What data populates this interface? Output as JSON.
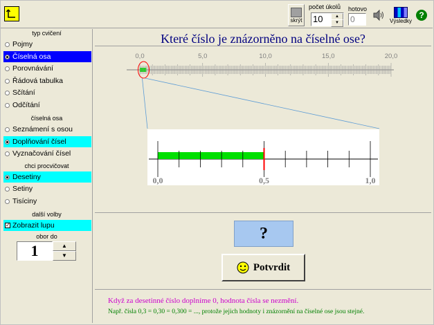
{
  "toolbar": {
    "hide_label": "skrýt",
    "task_count_label": "počet úkolů",
    "task_count_value": "10",
    "done_label": "hotovo",
    "done_value": "0",
    "results_label": "Výsledky",
    "help_symbol": "?"
  },
  "sidebar": {
    "section1_title": "typ cvičení",
    "section1_items": [
      "Pojmy",
      "Číselná osa",
      "Porovnávání",
      "Řádová tabulka",
      "Sčítání",
      "Odčítání"
    ],
    "section2_title": "číselná osa",
    "section2_items": [
      "Seznámení s osou",
      "Doplňování čísel",
      "Vyznačování čísel"
    ],
    "section3_title": "chci procvičovat",
    "section3_items": [
      "Desetiny",
      "Setiny",
      "Tisíciny"
    ],
    "section4_title": "další volby",
    "magnifier_label": "Zobrazit lupu",
    "range_label": "obor do",
    "range_value": "1"
  },
  "main": {
    "question": "Které číslo je znázorněno na číselné ose?",
    "axis_labels": [
      "0,0",
      "5,0",
      "10,0",
      "15,0",
      "20,0"
    ],
    "zoom_labels": [
      "0,0",
      "0,5",
      "1,0"
    ],
    "answer_placeholder": "?",
    "confirm_label": "Potvrdit",
    "hint1": "Když za desetinné číslo doplníme 0, hodnota čísla se nezmění.",
    "hint2": "Např. čísla 0,3 = 0,30 = 0,300 = ..., protože jejich hodnoty i znázornění na číselné ose jsou stejné."
  },
  "colors": {
    "highlight_blue": "#0000ff",
    "highlight_cyan": "#00ffff",
    "question_text": "#000080",
    "bar_fill": "#00e000",
    "marker": "#ff0000",
    "answer_button": "#a7c8f0",
    "hint1": "#cc00cc",
    "hint2": "#008000"
  },
  "shown_value": 0.5
}
